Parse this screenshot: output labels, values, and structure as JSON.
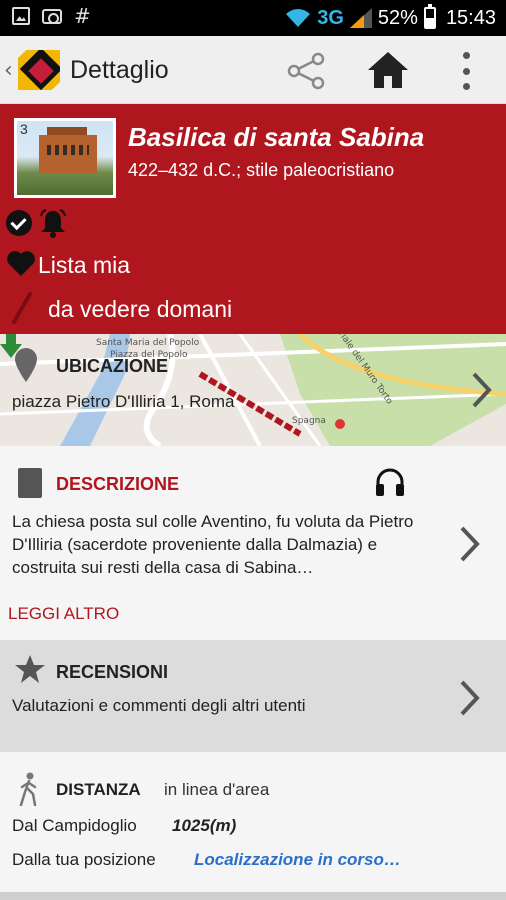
{
  "status_bar": {
    "network": "3G",
    "battery_percent": "52%",
    "battery_level": 0.52,
    "time": "15:43",
    "icons": [
      "image-icon",
      "camera-icon",
      "hash-icon",
      "wifi-icon",
      "signal-icon",
      "battery-icon"
    ]
  },
  "action_bar": {
    "title": "Dettaglio",
    "icons": [
      "back-icon",
      "app-logo",
      "share-icon",
      "home-icon",
      "overflow-menu-icon"
    ]
  },
  "hero": {
    "thumb_number": "3",
    "title": "Basilica di santa Sabina",
    "subtitle": "422–432 d.C.; stile paleocristiano",
    "my_list_label": "Lista mia",
    "note_label": "da vedere domani",
    "background_color": "#b0161e"
  },
  "location": {
    "title": "UBICAZIONE",
    "address": "piazza Pietro D'Illiria 1, Roma",
    "map_labels": [
      "Santa Maria del Popolo",
      "Piazza del Popolo",
      "Viale del Muro Torto",
      "Spagna"
    ]
  },
  "description": {
    "title": "DESCRIZIONE",
    "text": "La chiesa posta sul colle Aventino, fu voluta da Pietro D'Illiria (sacerdote proveniente dalla Dalmazia) e costruita sui resti della casa di Sabina…",
    "read_more": "LEGGI ALTRO",
    "accent_color": "#b0161e"
  },
  "reviews": {
    "title": "RECENSIONI",
    "text": "Valutazioni e commenti degli altri utenti"
  },
  "distance": {
    "title": "DISTANZA",
    "subtitle": "in linea d'area",
    "rows": [
      {
        "label": "Dal Campidoglio",
        "value": "1025(m)"
      },
      {
        "label": "Dalla tua posizione",
        "value": "Localizzazione in corso…"
      }
    ],
    "link_color": "#2a6fc9"
  }
}
